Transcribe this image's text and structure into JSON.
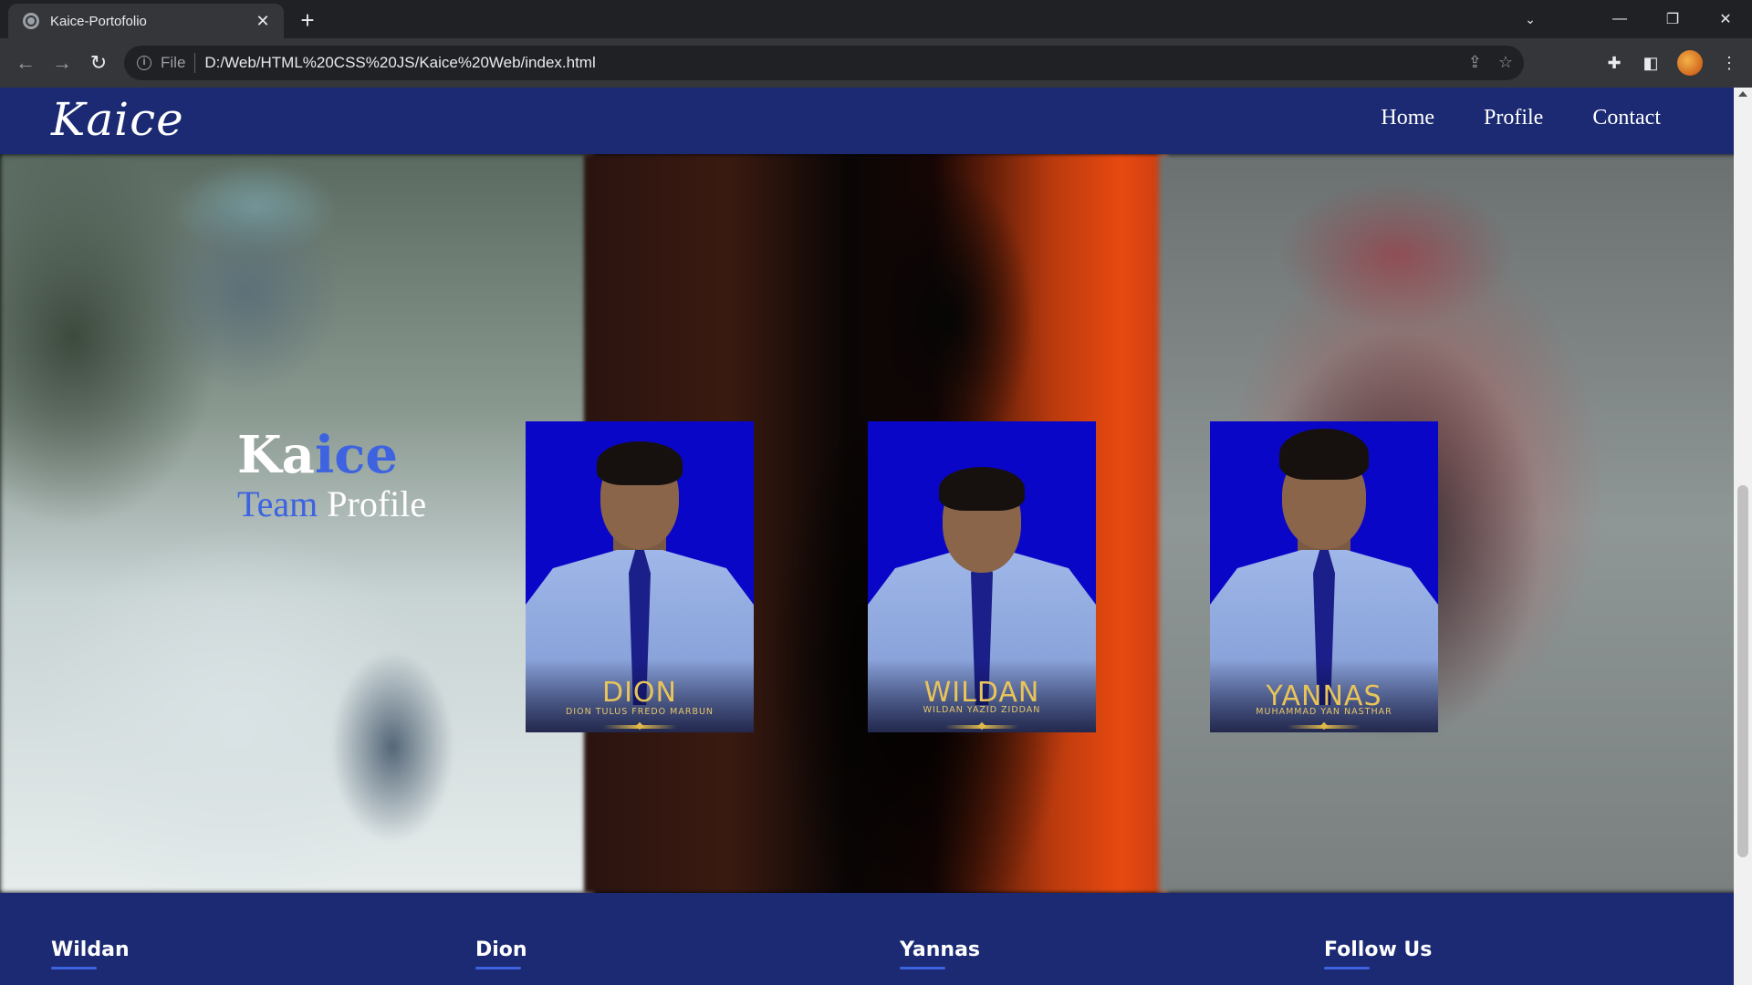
{
  "browser": {
    "tab_title": "Kaice-Portofolio",
    "scheme": "File",
    "url": "D:/Web/HTML%20CSS%20JS/Kaice%20Web/index.html"
  },
  "site": {
    "logo": "Kaice",
    "nav": [
      "Home",
      "Profile",
      "Contact"
    ]
  },
  "hero": {
    "title_part1": "Ka",
    "title_part2": "ice",
    "sub_part1": "Team",
    "sub_part2": "Profile"
  },
  "cards": [
    {
      "name": "DION",
      "fullname": "DION TULUS FREDO MARBUN"
    },
    {
      "name": "WILDAN",
      "fullname": "WILDAN YAZID ZIDDAN"
    },
    {
      "name": "YANNAS",
      "fullname": "MUHAMMAD YAN NASTHAR"
    }
  ],
  "footer": {
    "columns": [
      "Wildan",
      "Dion",
      "Yannas",
      "Follow Us"
    ]
  },
  "colors": {
    "nav_bg": "#1b2a72",
    "accent_blue": "#3d63e0",
    "card_bg": "#0a06c8",
    "gold": "#e8c45a"
  },
  "icons": [
    "globe-icon",
    "close-icon",
    "plus-icon",
    "back-arrow-icon",
    "forward-arrow-icon",
    "reload-icon",
    "info-icon",
    "share-icon",
    "star-icon",
    "puzzle-icon",
    "sidepanel-icon",
    "menu-dots-icon"
  ]
}
